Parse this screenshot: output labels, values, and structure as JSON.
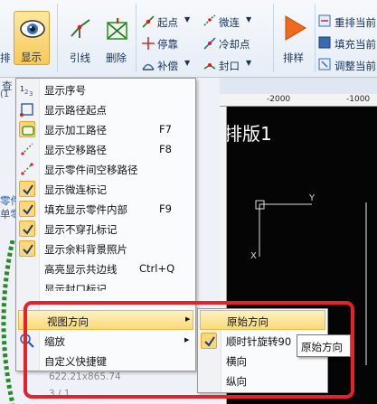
{
  "ribbon": {
    "tab_partial": "排",
    "display_label": "显示",
    "lead_label": "引线",
    "delete_label": "删除",
    "start_point_label": "起点",
    "stop_label": "停靠",
    "compensate_label": "补偿",
    "micro_link_label": "微连",
    "cooling_point_label": "冷却点",
    "seal_label": "封口",
    "nesting_label": "排样",
    "reorder_label": "重排当前",
    "fill_label": "填充当前",
    "adjust_label": "调整当前"
  },
  "left_panel": {
    "tab_partial": "查",
    "coord_partial": "(1",
    "parts_partial": "零件",
    "parts_partial2": "单零",
    "size_text": "622.21x865.74",
    "count_text": "3 / 1"
  },
  "canvas": {
    "title": "排版1",
    "ruler_ticks": [
      "-2000",
      "-1000"
    ],
    "axis_y": "Y",
    "axis_x": "X"
  },
  "menu": {
    "items": [
      {
        "label": "显示序号",
        "shortcut": "",
        "checked": false,
        "icon": "sequence-number-icon"
      },
      {
        "label": "显示路径起点",
        "shortcut": "",
        "checked": false,
        "icon": "path-start-icon"
      },
      {
        "label": "显示加工路径",
        "shortcut": "F7",
        "checked": true,
        "icon": "machining-path-icon"
      },
      {
        "label": "显示空移路径",
        "shortcut": "F8",
        "checked": false,
        "icon": "idle-path-icon"
      },
      {
        "label": "显示零件间空移路径",
        "shortcut": "",
        "checked": false,
        "icon": "inter-part-idle-icon"
      },
      {
        "label": "显示微连标记",
        "shortcut": "",
        "checked": true,
        "icon": "check-icon"
      },
      {
        "label": "填充显示零件内部",
        "shortcut": "F9",
        "checked": true,
        "icon": "check-icon"
      },
      {
        "label": "显示不穿孔标记",
        "shortcut": "",
        "checked": true,
        "icon": "check-icon"
      },
      {
        "label": "显示余料背景照片",
        "shortcut": "",
        "checked": true,
        "icon": "check-icon"
      },
      {
        "label": "高亮显示共边线",
        "shortcut": "Ctrl+Q",
        "checked": false,
        "icon": ""
      },
      {
        "label": "显示封口标记",
        "shortcut": "",
        "checked": false,
        "icon": ""
      },
      {
        "label": "视图方向",
        "shortcut": "",
        "checked": false,
        "icon": "",
        "submenu": true
      },
      {
        "label": "缩放",
        "shortcut": "",
        "checked": false,
        "icon": "zoom-icon",
        "submenu": true
      },
      {
        "label": "自定义快捷键",
        "shortcut": "",
        "checked": false,
        "icon": ""
      }
    ]
  },
  "submenu": {
    "items": [
      {
        "label": "原始方向",
        "checked": false
      },
      {
        "label": "顺时针旋转90",
        "checked": true
      },
      {
        "label": "横向",
        "checked": false
      },
      {
        "label": "纵向",
        "checked": false
      }
    ]
  },
  "tooltip": "原始方向",
  "colors": {
    "highlight_border": "#e8202a",
    "menu_highlight": "#fbdb77",
    "canvas_bg": "#050505"
  }
}
